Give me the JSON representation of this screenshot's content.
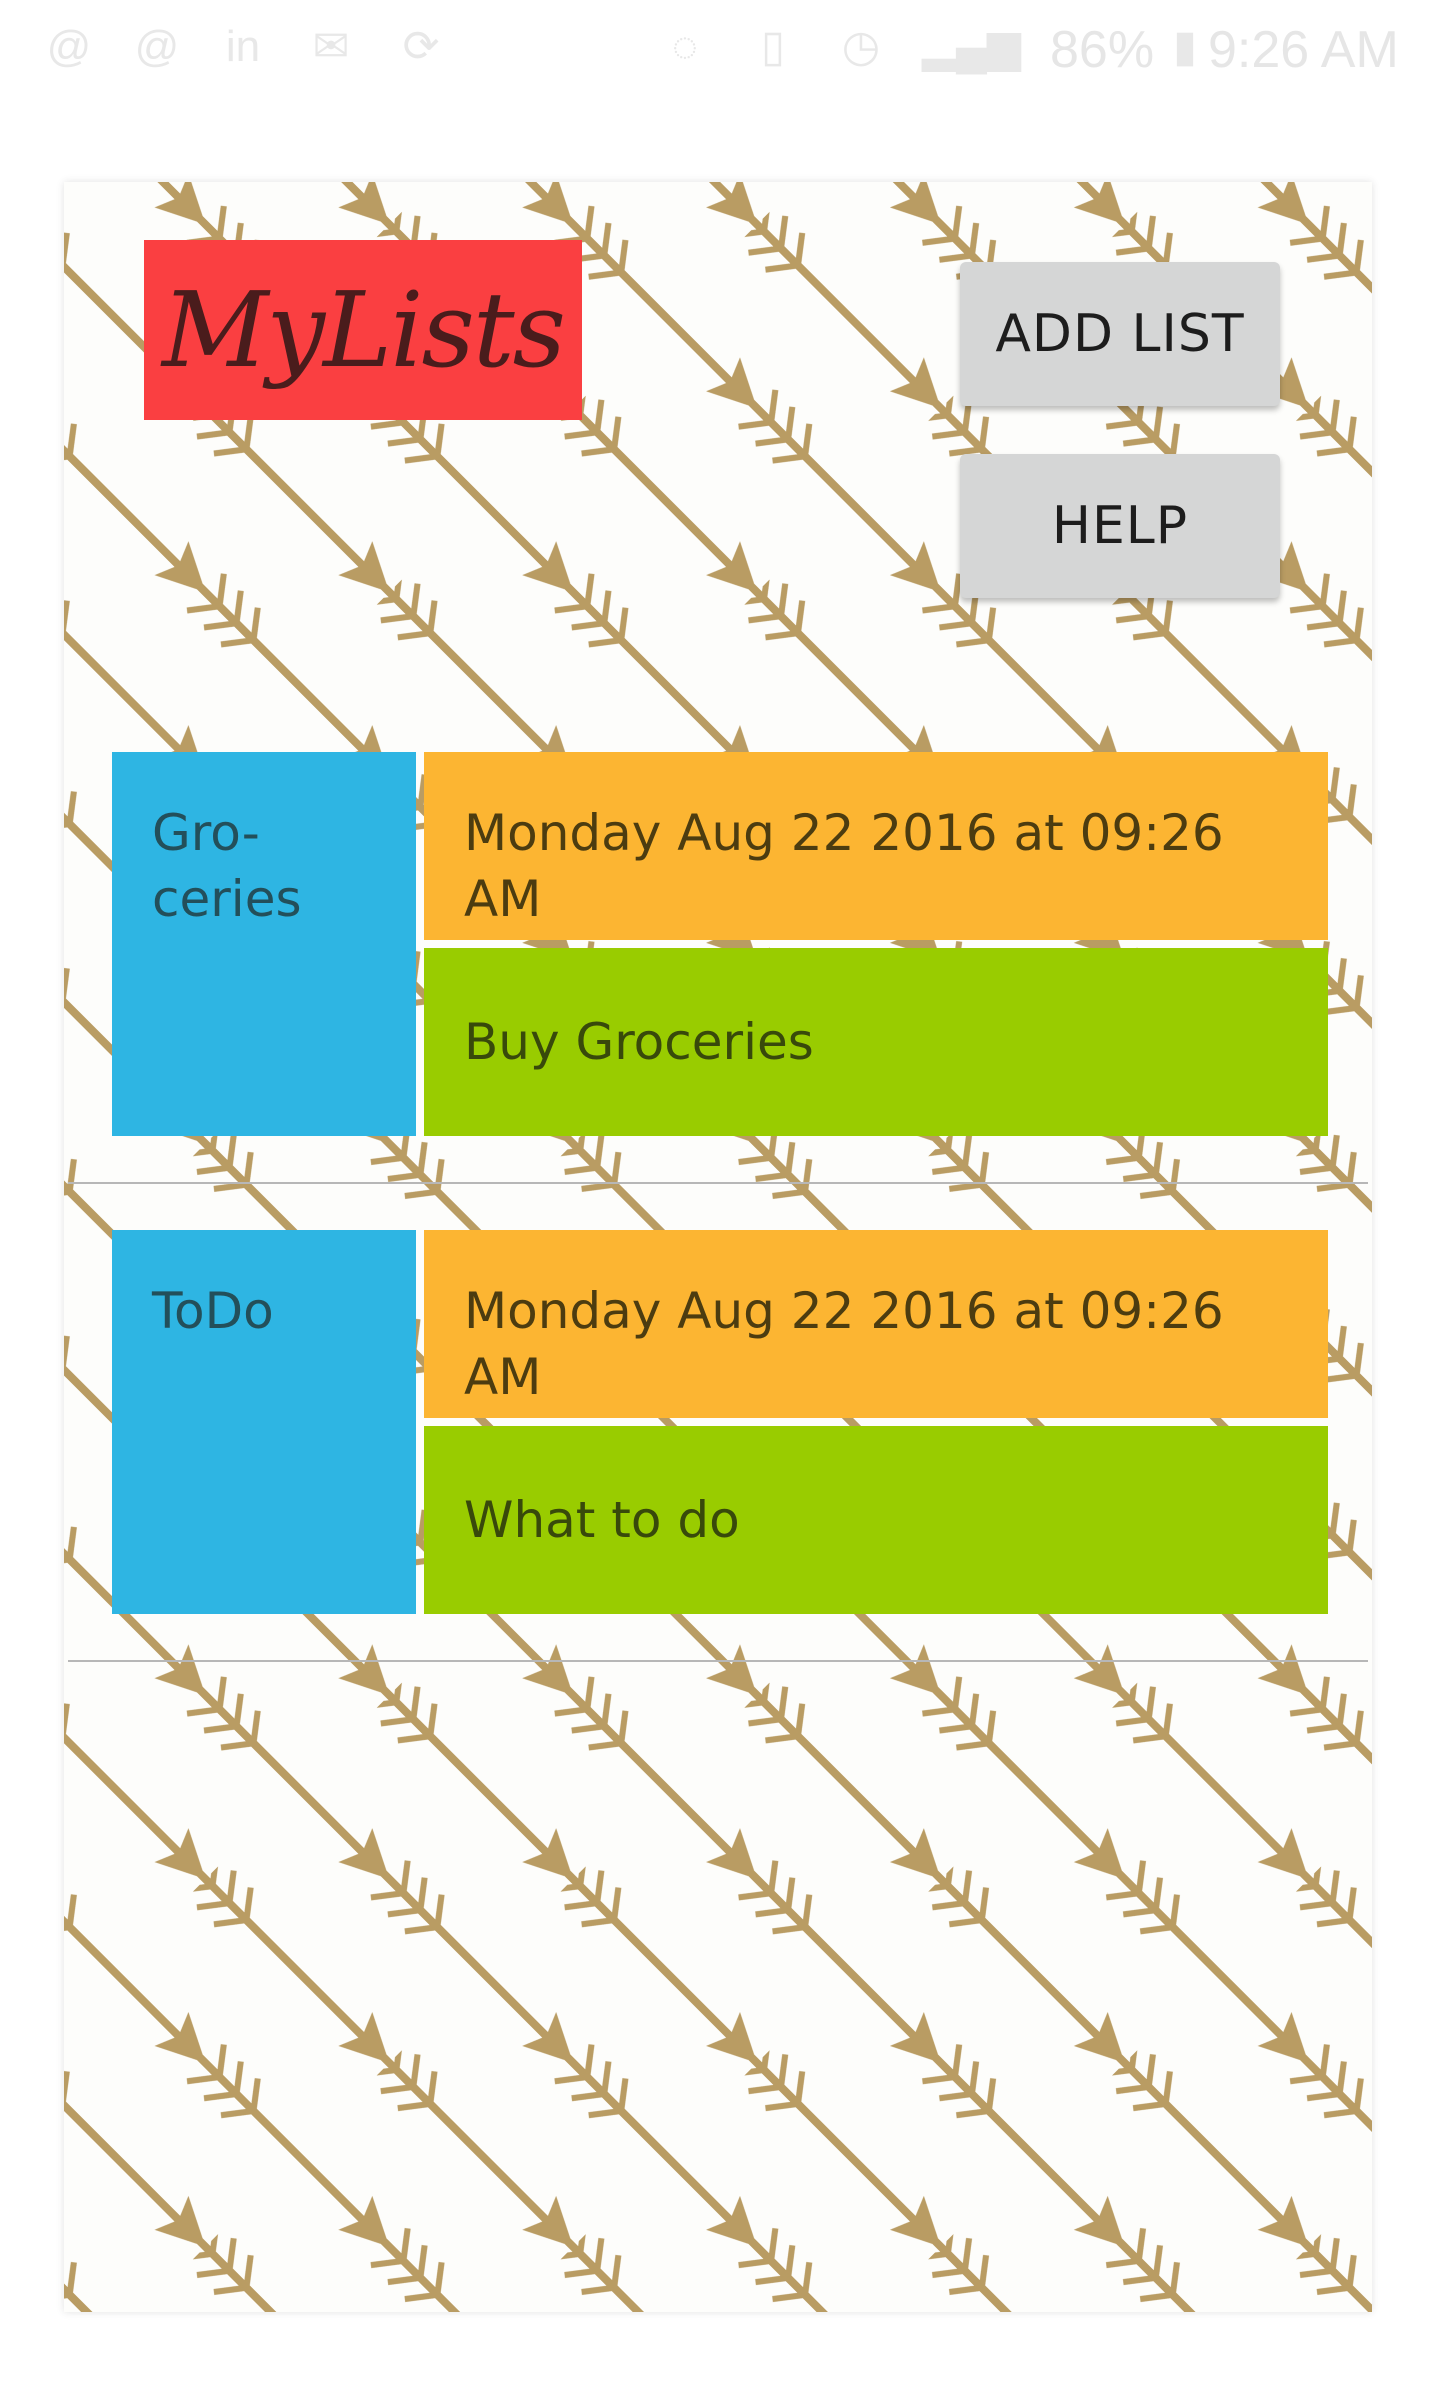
{
  "status_bar": {
    "battery": "86%",
    "time": "9:26 AM",
    "left_icons": [
      "at-icon",
      "at-icon",
      "linkedin-icon",
      "mail-icon",
      "sync-icon"
    ],
    "right_icons": [
      "nfc-icon",
      "vibrate-icon",
      "alarm-icon",
      "signal-icon",
      "battery-icon"
    ]
  },
  "app": {
    "title": "MyLists",
    "add_list_label": "ADD LIST",
    "help_label": "HELP"
  },
  "lists": [
    {
      "category": "Gro- ceries",
      "date": "Monday Aug 22 2016 at 09:26 AM",
      "description": "Buy Groceries"
    },
    {
      "category": "ToDo",
      "date": "Monday Aug 22 2016 at 09:26 AM",
      "description": "What to do"
    }
  ],
  "colors": {
    "title_bg": "#fa3f41",
    "category_bg": "#2eb5e3",
    "date_bg": "#fcb532",
    "description_bg": "#99cc00",
    "button_bg": "#d5d6d6",
    "arrow": "#b99c63"
  }
}
